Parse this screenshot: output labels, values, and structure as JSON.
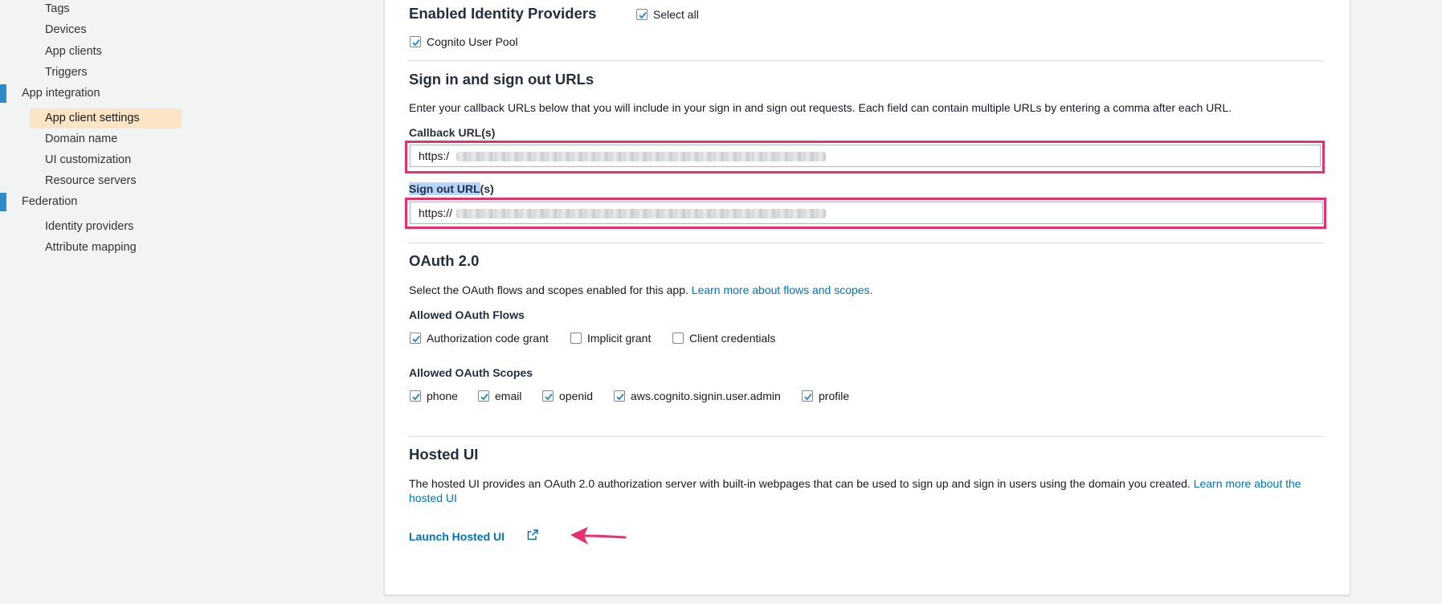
{
  "sidebar": {
    "items_top": [
      {
        "label": "Tags"
      },
      {
        "label": "Devices"
      },
      {
        "label": "App clients"
      },
      {
        "label": "Triggers"
      }
    ],
    "section_app_integration": "App integration",
    "app_integration_items": [
      {
        "label": "App client settings",
        "active": true
      },
      {
        "label": "Domain name"
      },
      {
        "label": "UI customization"
      },
      {
        "label": "Resource servers"
      }
    ],
    "section_federation": "Federation",
    "federation_items": [
      {
        "label": "Identity providers"
      },
      {
        "label": "Attribute mapping"
      }
    ]
  },
  "identity_providers": {
    "title": "Enabled Identity Providers",
    "select_all_label": "Select all",
    "select_all_checked": true,
    "cognito_label": "Cognito User Pool",
    "cognito_checked": true
  },
  "sign_urls": {
    "title": "Sign in and sign out URLs",
    "description": "Enter your callback URLs below that you will include in your sign in and sign out requests. Each field can contain multiple URLs by entering a comma after each URL.",
    "callback_label": "Callback URL(s)",
    "callback_value": "https:/",
    "signout_label_selected": "Sign out URL",
    "signout_label_rest": "(s)",
    "signout_value": "https://"
  },
  "oauth": {
    "title": "OAuth 2.0",
    "description": "Select the OAuth flows and scopes enabled for this app.",
    "learn_more_link": "Learn more about flows and scopes.",
    "flows_label": "Allowed OAuth Flows",
    "flows": [
      {
        "label": "Authorization code grant",
        "checked": true
      },
      {
        "label": "Implicit grant",
        "checked": false
      },
      {
        "label": "Client credentials",
        "checked": false
      }
    ],
    "scopes_label": "Allowed OAuth Scopes",
    "scopes": [
      {
        "label": "phone",
        "checked": true
      },
      {
        "label": "email",
        "checked": true
      },
      {
        "label": "openid",
        "checked": true
      },
      {
        "label": "aws.cognito.signin.user.admin",
        "checked": true
      },
      {
        "label": "profile",
        "checked": true
      }
    ]
  },
  "hosted_ui": {
    "title": "Hosted UI",
    "description": "The hosted UI provides an OAuth 2.0 authorization server with built-in webpages that can be used to sign up and sign in users using the domain you created.",
    "learn_more_link_part1": "Learn more about the",
    "learn_more_link_part2": "hosted UI",
    "launch_label": "Launch Hosted UI",
    "launch_icon": "external-link-icon"
  },
  "colors": {
    "accent": "#0073bb",
    "highlight": "#e8306d",
    "active_nav": "#fbe5c5",
    "checkbox": "#2e8bc9"
  }
}
